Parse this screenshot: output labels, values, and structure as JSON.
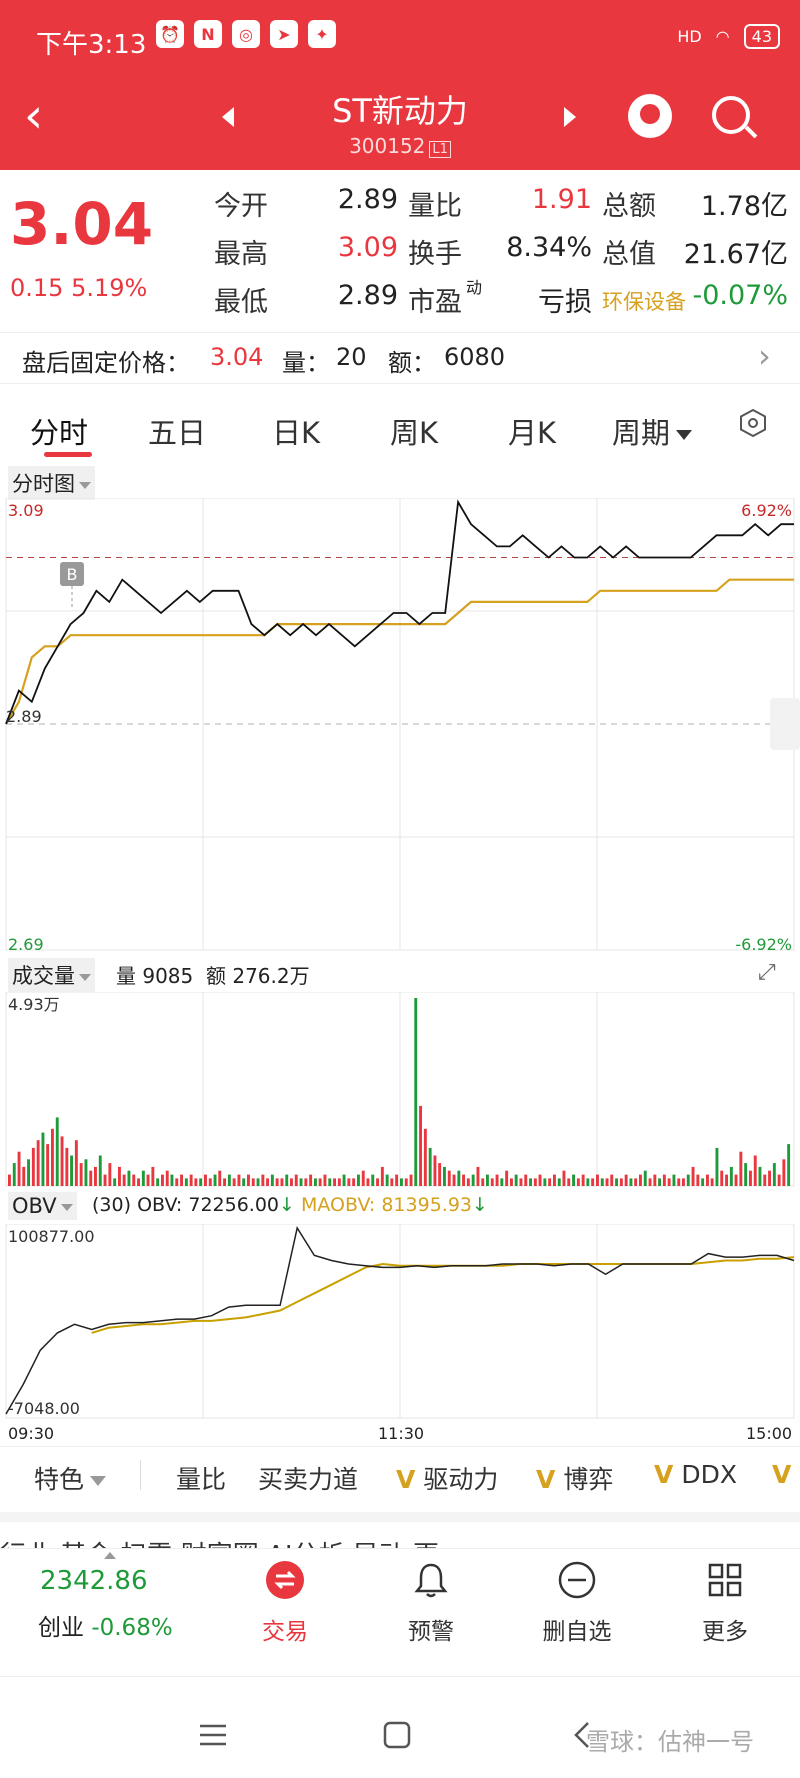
{
  "status_bar": {
    "time": "下午3:13",
    "signal": "HD",
    "battery": "43"
  },
  "header": {
    "title": "ST新动力",
    "code": "300152",
    "code_tag": "L1"
  },
  "quote": {
    "price": "3.04",
    "change": "0.15",
    "change_pct": "5.19%",
    "rows": [
      [
        {
          "label": "今开",
          "value": "2.89",
          "tone": "dark"
        },
        {
          "label": "量比",
          "value": "1.91",
          "tone": "red"
        },
        {
          "label": "总额",
          "value": "1.78亿",
          "tone": "dark"
        }
      ],
      [
        {
          "label": "最高",
          "value": "3.09",
          "tone": "red"
        },
        {
          "label": "换手",
          "value": "8.34%",
          "tone": "dark"
        },
        {
          "label": "总值",
          "value": "21.67亿",
          "tone": "dark"
        }
      ],
      [
        {
          "label": "最低",
          "value": "2.89",
          "tone": "dark"
        },
        {
          "label": "市盈",
          "sup": "动",
          "value": "亏损",
          "tone": "dark"
        },
        {
          "label": "环保设备",
          "value": "-0.07%",
          "tone": "green"
        }
      ]
    ]
  },
  "after_hours": {
    "label": "盘后固定价格：",
    "price": "3.04",
    "vol_label": "量：",
    "vol": "20",
    "amt_label": "额：",
    "amt": "6080"
  },
  "tabs": [
    "分时",
    "五日",
    "日K",
    "周K",
    "月K",
    "周期"
  ],
  "chart_header": "分时图",
  "price_chart": {
    "high_label": "3.09",
    "mid_label": "2.89",
    "low_label": "2.69",
    "pct_high": "6.92%",
    "pct_low": "-6.92%",
    "marker": "B"
  },
  "volume_header": {
    "title": "成交量",
    "vol_label": "量",
    "vol": "9085",
    "amt_label": "额",
    "amt": "276.2万",
    "max_label": "4.93万"
  },
  "obv_header": {
    "title": "OBV",
    "period": "(30)",
    "obv_text": "OBV: 72256.00",
    "maobv_text": "MAOBV: 81395.93",
    "max_label": "100877.00",
    "min_label": "-7048.00"
  },
  "time_axis": [
    "09:30",
    "11:30",
    "15:00"
  ],
  "indicators": [
    {
      "label": "特色",
      "v": false
    },
    {
      "label": "量比",
      "v": false
    },
    {
      "label": "买卖力道",
      "v": false
    },
    {
      "label": "驱动力",
      "v": true
    },
    {
      "label": "博弈",
      "v": true
    },
    {
      "label": "DDX",
      "v": true
    }
  ],
  "partial_tabs": "行业    基金    扫雷    财富圈    AI分析    异动    更",
  "bottom_nav": {
    "index_value": "2342.86",
    "index_name": "创业",
    "index_pct": "-0.68%",
    "items": [
      "交易",
      "预警",
      "删自选",
      "更多"
    ]
  },
  "watermark": "雪球：估神一号",
  "colors": {
    "brand": "#e8373f",
    "up": "#e8373f",
    "down": "#1f9a3a",
    "avg": "#d6a11e"
  },
  "chart_data": [
    {
      "type": "line",
      "series": [
        {
          "values": [
            2.89,
            2.92,
            2.91,
            2.94,
            2.96,
            2.98,
            2.99,
            3.01,
            3.0,
            3.02,
            3.01,
            3.0,
            2.99,
            3.0,
            3.01,
            3.0,
            3.01,
            3.01,
            3.01,
            2.98,
            2.97,
            2.98,
            2.97,
            2.98,
            2.97,
            2.98,
            2.97,
            2.96,
            2.97,
            2.98,
            2.99,
            2.99,
            2.98,
            2.99,
            2.99,
            3.09,
            3.07,
            3.06,
            3.05,
            3.05,
            3.06,
            3.05,
            3.04,
            3.05,
            3.04,
            3.04,
            3.05,
            3.04,
            3.05,
            3.04,
            3.04,
            3.04,
            3.04,
            3.04,
            3.05,
            3.06,
            3.06,
            3.06,
            3.07,
            3.06,
            3.07,
            3.07
          ]
        },
        {
          "values": [
            2.89,
            2.91,
            2.95,
            2.96,
            2.96,
            2.97,
            2.97,
            2.97,
            2.97,
            2.97,
            2.97,
            2.97,
            2.97,
            2.97,
            2.97,
            2.97,
            2.97,
            2.97,
            2.97,
            2.97,
            2.97,
            2.98,
            2.98,
            2.98,
            2.98,
            2.98,
            2.98,
            2.98,
            2.98,
            2.98,
            2.98,
            2.98,
            2.98,
            2.98,
            2.98,
            2.99,
            3.0,
            3.0,
            3.0,
            3.0,
            3.0,
            3.0,
            3.0,
            3.0,
            3.0,
            3.0,
            3.01,
            3.01,
            3.01,
            3.01,
            3.01,
            3.01,
            3.01,
            3.01,
            3.01,
            3.01,
            3.02,
            3.02,
            3.02,
            3.02,
            3.02,
            3.02
          ]
        }
      ],
      "ylim": [
        2.69,
        3.09
      ]
    },
    {
      "type": "bar",
      "values": [
        0.3,
        0.6,
        0.9,
        0.5,
        0.7,
        1.0,
        1.2,
        1.4,
        1.1,
        1.5,
        1.8,
        1.3,
        1.0,
        0.8,
        1.2,
        0.6,
        0.7,
        0.4,
        0.5,
        0.8,
        0.3,
        0.6,
        0.2,
        0.5,
        0.3,
        0.4,
        0.3,
        0.2,
        0.4,
        0.3,
        0.5,
        0.2,
        0.3,
        0.4,
        0.3,
        0.2,
        0.3,
        0.2,
        0.3,
        0.2,
        0.2,
        0.3,
        0.2,
        0.3,
        0.4,
        0.2,
        0.3,
        0.2,
        0.3,
        0.2,
        0.3,
        0.2,
        0.2,
        0.3,
        0.2,
        0.3,
        0.2,
        0.2,
        0.3,
        0.2,
        0.3,
        0.2,
        0.2,
        0.3,
        0.2,
        0.2,
        0.3,
        0.2,
        0.2,
        0.2,
        0.3,
        0.2,
        0.2,
        0.3,
        0.4,
        0.2,
        0.3,
        0.2,
        0.5,
        0.3,
        0.2,
        0.3,
        0.2,
        0.2,
        0.3,
        4.93,
        2.1,
        1.5,
        1.0,
        0.8,
        0.6,
        0.5,
        0.4,
        0.3,
        0.4,
        0.3,
        0.2,
        0.3,
        0.5,
        0.2,
        0.3,
        0.2,
        0.3,
        0.2,
        0.4,
        0.2,
        0.3,
        0.2,
        0.3,
        0.2,
        0.2,
        0.3,
        0.2,
        0.2,
        0.3,
        0.2,
        0.4,
        0.2,
        0.3,
        0.2,
        0.3,
        0.2,
        0.2,
        0.3,
        0.2,
        0.2,
        0.3,
        0.2,
        0.2,
        0.3,
        0.2,
        0.2,
        0.3,
        0.4,
        0.2,
        0.3,
        0.2,
        0.3,
        0.2,
        0.3,
        0.2,
        0.2,
        0.3,
        0.5,
        0.3,
        0.2,
        0.3,
        0.2,
        1.0,
        0.4,
        0.3,
        0.5,
        0.3,
        0.9,
        0.6,
        0.4,
        0.8,
        0.5,
        0.3,
        0.4,
        0.6,
        0.3,
        0.7,
        1.1
      ],
      "ylim": [
        0,
        4.93
      ]
    },
    {
      "type": "line",
      "series": [
        {
          "values": [
            -7048,
            10000,
            30000,
            40000,
            45000,
            42000,
            45000,
            46000,
            46000,
            47000,
            48000,
            48000,
            50000,
            55000,
            56000,
            56000,
            56000,
            100877,
            85000,
            82000,
            80000,
            79000,
            78000,
            78000,
            79000,
            78000,
            79000,
            79000,
            79000,
            80000,
            80000,
            80000,
            79000,
            80000,
            80000,
            74000,
            80000,
            80000,
            80000,
            80000,
            80000,
            86000,
            84000,
            84000,
            85000,
            85000,
            82000
          ]
        },
        {
          "values": [
            null,
            null,
            null,
            null,
            null,
            40000,
            43000,
            44000,
            45000,
            45000,
            46000,
            47000,
            47000,
            48000,
            49000,
            51000,
            53000,
            58000,
            63000,
            68000,
            73000,
            78000,
            80000,
            79000,
            79000,
            79000,
            79000,
            79000,
            79000,
            79000,
            80000,
            80000,
            80000,
            80000,
            80000,
            80000,
            80000,
            80000,
            80000,
            80000,
            80000,
            81000,
            82000,
            82000,
            83000,
            83000,
            84000
          ]
        }
      ],
      "ylim": [
        -7048,
        100877
      ]
    }
  ]
}
